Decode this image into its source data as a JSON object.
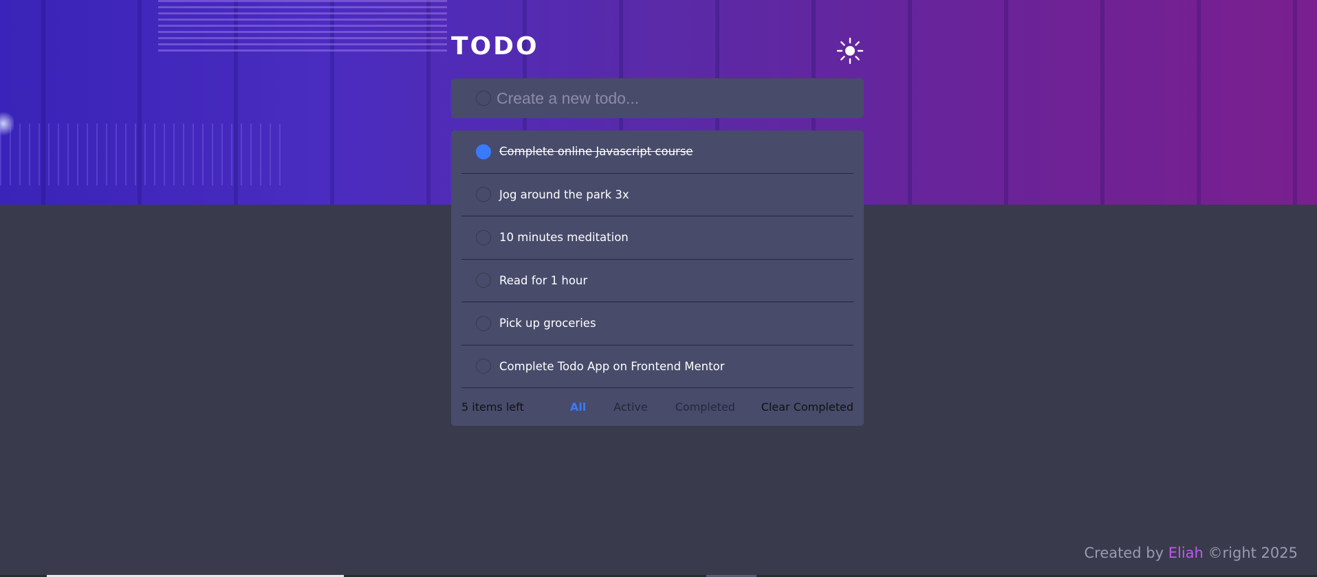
{
  "app": {
    "title": "TODO",
    "theme_icon": "sun-icon"
  },
  "new_todo": {
    "placeholder": "Create a new todo...",
    "value": ""
  },
  "todos": [
    {
      "text": "Complete online Javascript course",
      "completed": true
    },
    {
      "text": "Jog around the park 3x",
      "completed": false
    },
    {
      "text": "10 minutes meditation",
      "completed": false
    },
    {
      "text": "Read for 1 hour",
      "completed": false
    },
    {
      "text": "Pick up groceries",
      "completed": false
    },
    {
      "text": "Complete Todo App on Frontend Mentor",
      "completed": false
    }
  ],
  "footer": {
    "items_left": "5 items left",
    "filters": {
      "all": "All",
      "active": "Active",
      "completed": "Completed"
    },
    "active_filter": "all",
    "clear_label": "Clear Completed"
  },
  "credit": {
    "prefix": "Created by",
    "author": "Eliah",
    "suffix": "©right 2025"
  },
  "colors": {
    "accent": "#3a7bfd",
    "author": "#c058f3",
    "background": "#393a4c",
    "card": "#484b6a"
  }
}
